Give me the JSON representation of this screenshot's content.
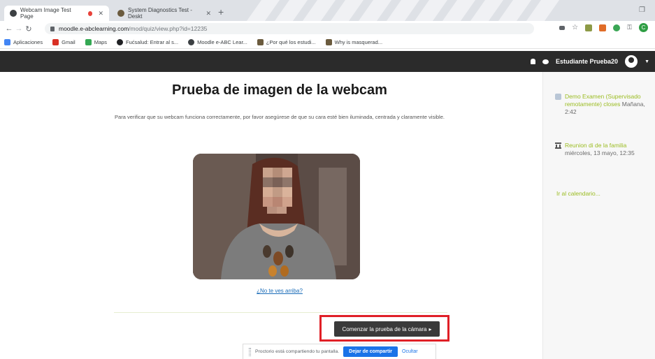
{
  "browser": {
    "tabs": [
      {
        "title": "Webcam Image Test Page",
        "active": true,
        "recording": true
      },
      {
        "title": "System Diagnostics Test - Deskt",
        "active": false,
        "recording": false
      }
    ],
    "new_tab": "+",
    "url_host": "moodle.e-abclearning.com",
    "url_path": "/mod/quiz/view.php?id=12235",
    "bookmarks": [
      {
        "label": "Aplicaciones",
        "icon": "apps-icon",
        "color": "#4285f4"
      },
      {
        "label": "Gmail",
        "icon": "gmail-icon",
        "color": "#d93025"
      },
      {
        "label": "Maps",
        "icon": "maps-icon",
        "color": "#34a853"
      },
      {
        "label": "Fućsalud: Entrar al s...",
        "icon": "site-icon",
        "color": "#202124"
      },
      {
        "label": "Moodle e-ABC Lear...",
        "icon": "moodle-icon",
        "color": "#3c4043"
      },
      {
        "label": "¿Por qué los estudi...",
        "icon": "site-icon",
        "color": "#5f6368"
      },
      {
        "label": "Why is masquerad...",
        "icon": "site-icon",
        "color": "#5f6368"
      }
    ]
  },
  "navbar": {
    "user_name": "Estudiante Prueba20"
  },
  "main": {
    "title": "Prueba de imagen de la webcam",
    "intro": "Para verificar que su webcam funciona correctamente, por favor asegúrese de que su cara esté bien iluminada, centrada y claramente visible.",
    "help_link": "¿No te ves arriba?",
    "start_button": "Comenzar la prueba de la cámara",
    "start_button_arrow": "▸"
  },
  "sharebar": {
    "message": "Proctorio está compartiendo tu pantalla.",
    "stop_label": "Dejar de compartir",
    "hide_label": "Ocultar"
  },
  "calendar": {
    "events": [
      {
        "title": "Demo Examen (Supervisado remotamente) closes",
        "time": "Mañana, 2:42",
        "icon": "quiz-check-icon"
      },
      {
        "title": "Reunion di de la familia",
        "time": "miércoles, 13 mayo, 12:35",
        "icon": "site-event-icon"
      }
    ],
    "go_to_calendar": "Ir al calendario..."
  },
  "colors": {
    "navbar": "#2b2b2b",
    "accent_green": "#9bbc22",
    "highlight_red": "#e01f26",
    "link_blue": "#1a6cb8",
    "share_blue": "#1a73e8"
  }
}
